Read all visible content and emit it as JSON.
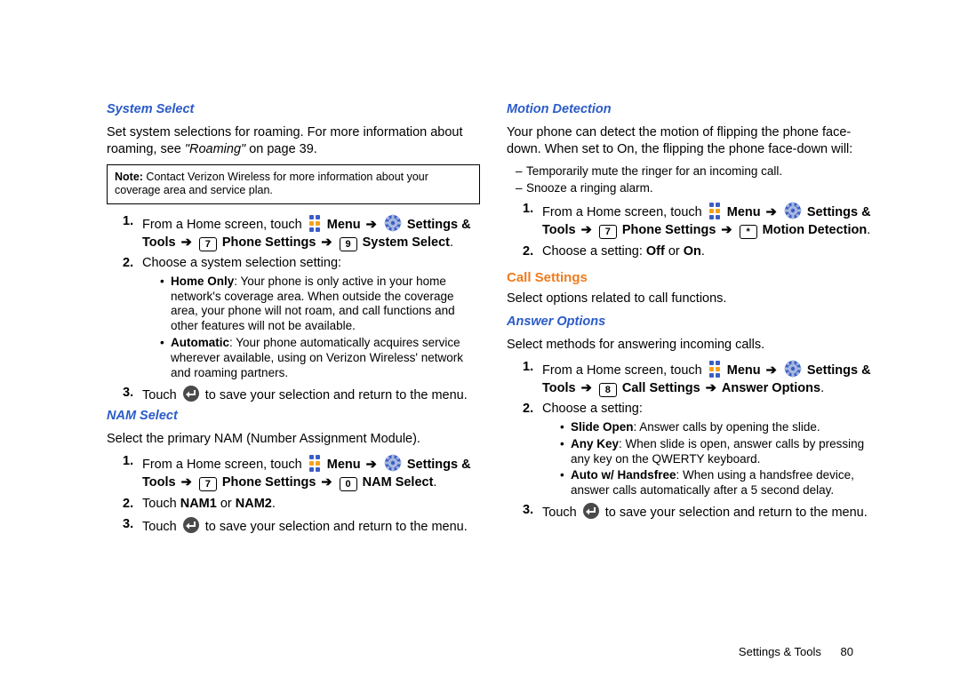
{
  "left": {
    "system_select": {
      "heading": "System Select",
      "intro_a": "Set system selections for roaming. For more information about roaming, see ",
      "intro_ref": "\"Roaming\"",
      "intro_b": " on page 39.",
      "note_label": "Note:",
      "note_text": " Contact Verizon Wireless for more information about your coverage area and service plan.",
      "step1_a": "From a Home screen, touch ",
      "menu": "Menu",
      "settings_tools": "Settings & Tools",
      "phone_settings": "Phone Settings",
      "system_select_label": "System Select",
      "key7": "7",
      "key9": "9",
      "step2": "Choose a system selection setting:",
      "opt1_label": "Home Only",
      "opt1_text": ": Your phone is only active in your home network's coverage area.  When outside the coverage area, your phone will not roam, and call functions and other features will not be available.",
      "opt2_label": "Automatic",
      "opt2_text": ": Your phone automatically acquires service wherever available, using on Verizon Wireless' network and roaming partners.",
      "step3_a": "Touch ",
      "step3_b": " to save your selection and return to the menu."
    },
    "nam_select": {
      "heading": "NAM Select",
      "intro": "Select the primary NAM (Number Assignment Module).",
      "step1_a": "From a Home screen, touch ",
      "menu": "Menu",
      "settings_tools": "Settings & Tools",
      "phone_settings": "Phone Settings",
      "nam_select_label": "NAM Select",
      "key7": "7",
      "key0": "0",
      "step2_a": "Touch ",
      "step2_b1": "NAM1",
      "step2_or": " or ",
      "step2_b2": "NAM2",
      "step2_c": ".",
      "step3_a": "Touch ",
      "step3_b": " to save your selection and return to the menu."
    }
  },
  "right": {
    "motion_detection": {
      "heading": "Motion Detection",
      "intro": "Your phone can detect the motion of flipping the phone face-down.  When set to On, the flipping the phone face-down will:",
      "dash1": "Temporarily mute the ringer for an incoming call.",
      "dash2": "Snooze a ringing alarm.",
      "step1_a": "From a Home screen, touch ",
      "menu": "Menu",
      "settings_tools": "Settings & Tools",
      "phone_settings": "Phone Settings",
      "motion_detection_label": "Motion Detection",
      "key7": "7",
      "keystar": "*",
      "step2_a": "Choose a setting: ",
      "off": "Off",
      "or": " or ",
      "on": "On",
      "period": "."
    },
    "call_settings": {
      "heading": "Call Settings",
      "intro": "Select options related to call functions."
    },
    "answer_options": {
      "heading": "Answer Options",
      "intro": "Select methods for answering incoming calls.",
      "step1_a": "From a Home screen, touch ",
      "menu": "Menu",
      "settings_tools": "Settings & Tools",
      "call_settings_label": "Call Settings",
      "answer_options_label": "Answer Options",
      "key8": "8",
      "step2": "Choose a setting:",
      "opt1_label": "Slide Open",
      "opt1_text": ": Answer calls by opening the slide.",
      "opt2_label": "Any Key",
      "opt2_text": ": When slide is open, answer calls by pressing any key on the QWERTY keyboard.",
      "opt3_label": "Auto w/ Handsfree",
      "opt3_text": ": When using a handsfree device, answer calls automatically after a 5 second delay.",
      "step3_a": "Touch ",
      "step3_b": " to save your selection and return to the menu."
    }
  },
  "footer": {
    "section": "Settings & Tools",
    "page": "80"
  },
  "glyphs": {
    "arrow": "➔"
  }
}
